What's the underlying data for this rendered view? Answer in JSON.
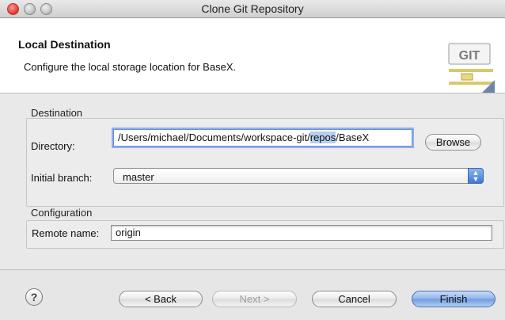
{
  "window": {
    "title": "Clone Git Repository"
  },
  "header": {
    "title": "Local Destination",
    "description": "Configure the local storage location for BaseX.",
    "logo_text": "GIT"
  },
  "destination": {
    "group_label": "Destination",
    "directory_label": "Directory:",
    "directory_value_before": "/Users/michael/Documents/workspace-git/",
    "directory_value_selected": "repos",
    "directory_value_after": "/BaseX",
    "browse_label": "Browse",
    "branch_label": "Initial branch:",
    "branch_value": "master"
  },
  "configuration": {
    "group_label": "Configuration",
    "remote_label": "Remote name:",
    "remote_value": "origin"
  },
  "footer": {
    "help_symbol": "?",
    "back_label": "< Back",
    "next_label": "Next >",
    "cancel_label": "Cancel",
    "finish_label": "Finish"
  }
}
